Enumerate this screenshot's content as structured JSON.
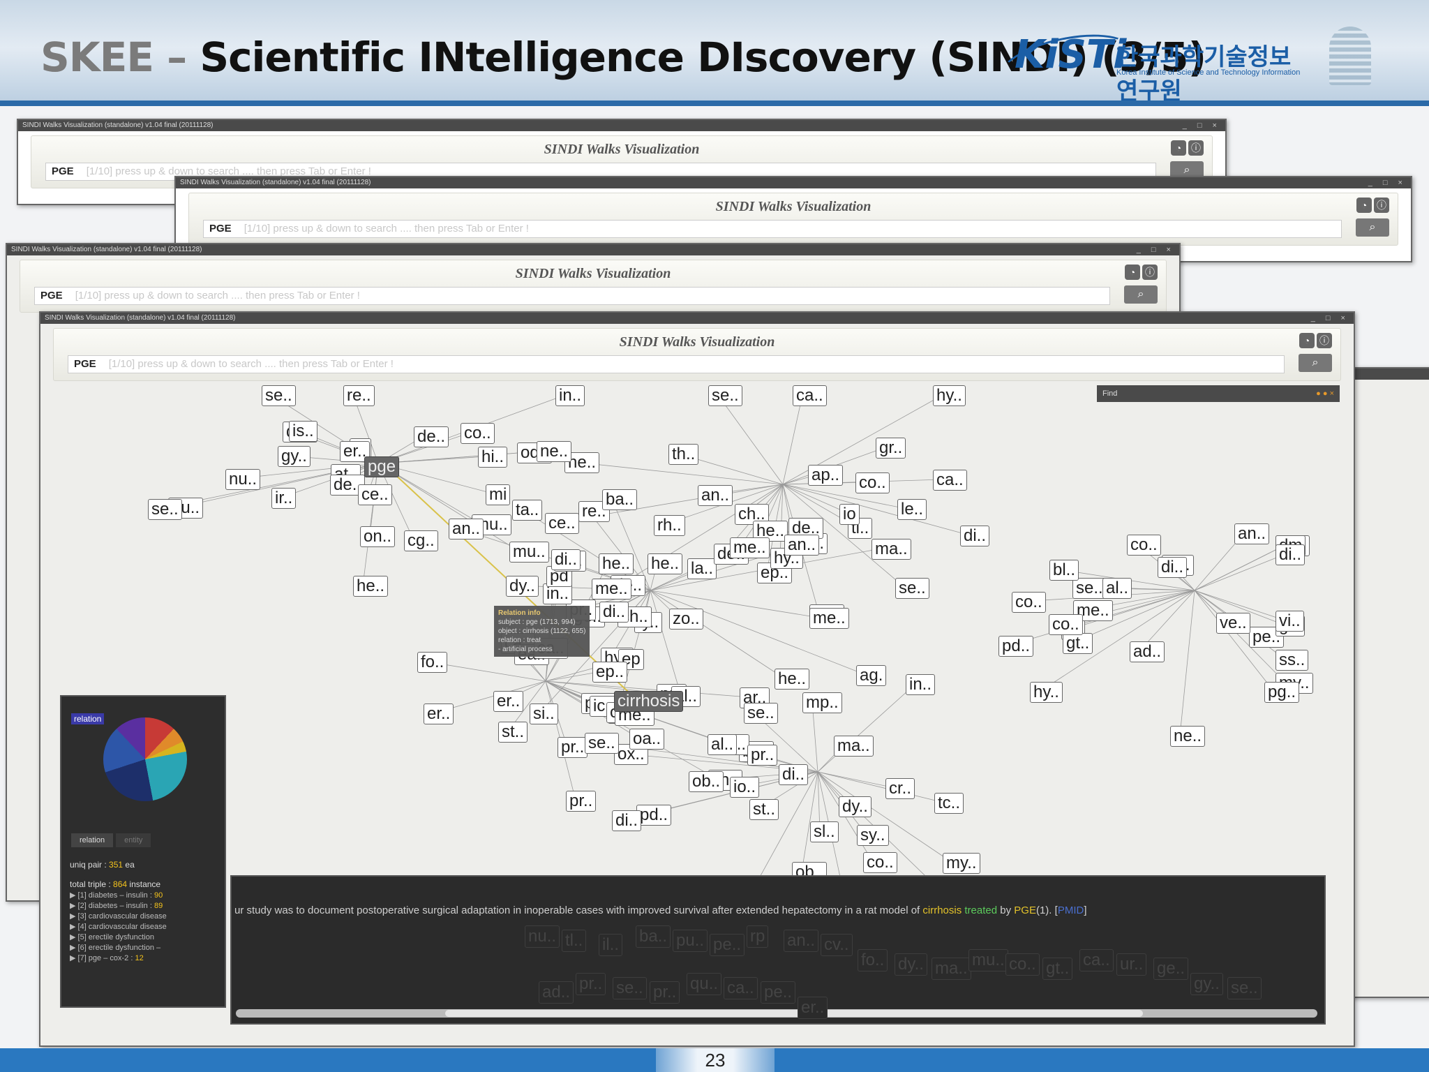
{
  "slide": {
    "brand": "SKEE",
    "dash": " – ",
    "title": "Scientific INtelligence DIscovery (SINDI) (3/5)",
    "logo_text": "KiSTi",
    "logo_kr": "한국과학기술정보연구원",
    "logo_en": "Korea Institute of Science and Technology Information",
    "page_number": "23"
  },
  "app": {
    "window_title": "SINDI Walks Visualization (standalone) v1.04 final (20111128)",
    "vis_title": "SINDI Walks Visualization",
    "search_value": "PGE",
    "search_placeholder": "[1/10] press up & down to search .... then press Tab or Enter !",
    "search_icon": "magnifier-icon",
    "find_label": "Find"
  },
  "graph": {
    "hub_labels": [
      "pge",
      "cirrhosis"
    ],
    "nodes": [
      "nu..",
      "tl..",
      "il..",
      "ba..",
      "pu..",
      "pe..",
      "rp",
      "an..",
      "cv..",
      "fo..",
      "dy..",
      "ma..",
      "mu..",
      "co..",
      "gt..",
      "ca..",
      "ur..",
      "ge..",
      "gy..",
      "se..",
      "ad..",
      "pr..",
      "se..",
      "pr..",
      "qu..",
      "ca..",
      "pe..",
      "er..",
      "tc..",
      "re..",
      "hi..",
      "rh..",
      "pd..",
      "er..",
      "sl..",
      "he..",
      "he..",
      "hy..",
      "co..",
      "in..",
      "di..",
      "hy..",
      "cg..",
      "se..",
      "ne..",
      "pr..",
      "al..",
      "ag.",
      "nu..",
      "th..",
      "my..",
      "ep",
      "cr..",
      "ba..",
      "se..",
      "an..",
      "ve..",
      "pa..",
      "ox..",
      "la..",
      "at..",
      "ep..",
      "gl..",
      "pr..",
      "ma..",
      "zo..",
      "er..",
      "ch..",
      "me..",
      "ar..",
      "pd..",
      "si..",
      "re..",
      "hy..",
      "ss..",
      "ic..",
      "sy..",
      "me..",
      "ir..",
      "he..",
      "se..",
      "ch..",
      "se..",
      "al..",
      "se..",
      "gr..",
      "co..",
      "he..",
      "se..",
      "ta..",
      "de..",
      "ca..",
      "co..",
      "pd",
      "ob..",
      "de..",
      "mi",
      "ce..",
      "di..",
      "ea..",
      "co..",
      "ty..",
      "od..",
      "le..",
      "pg..",
      "pr..",
      "th..",
      "cy..",
      "de..",
      "de..",
      "dm",
      "ox..",
      "io..",
      "ca..",
      "ce..",
      "di..",
      "co..",
      "ep..",
      "st..",
      "ch..",
      "mu..",
      "ap..",
      "al..",
      "st..",
      "mp..",
      "al..",
      "in..",
      "de..",
      "an..",
      "me..",
      "my..",
      "an..",
      "on..",
      "he..",
      "di..",
      "me..",
      "ob..",
      "he..",
      "ne..",
      "me..",
      "bl..",
      "oa..",
      "in..",
      "dy..",
      "is..",
      "io",
      "hy..",
      "di..",
      "di..",
      "di..",
      "co..",
      "an..",
      "vi.."
    ]
  },
  "info_box": {
    "heading": "Relation info",
    "lines": [
      "subject : pge (1713, 994)",
      "object : cirrhosis (1122, 655)",
      "relation : treat",
      "   - artificial process"
    ]
  },
  "relation_panel": {
    "title": "relation",
    "tabs": [
      "relation",
      "entity"
    ],
    "uniq_pair_label": "uniq pair : ",
    "uniq_pair_value": "351",
    "uniq_pair_unit": " ea",
    "total_triple_label": "total triple : ",
    "total_triple_value": "864",
    "total_triple_unit": " instance",
    "items": [
      {
        "label": "[1] diabetes – insulin : ",
        "count": "90"
      },
      {
        "label": "[2] diabetes – insulin : ",
        "count": "89"
      },
      {
        "label": "[3] cardiovascular disease",
        "count": ""
      },
      {
        "label": "[4] cardiovascular disease",
        "count": ""
      },
      {
        "label": "[5] erectile dysfunction",
        "count": ""
      },
      {
        "label": "[6] erectile dysfunction –",
        "count": ""
      },
      {
        "label": "[7] pge – cox-2 : ",
        "count": "12"
      }
    ],
    "pie_colors": [
      "#c73a36",
      "#e08a2a",
      "#d6b41f",
      "#2aa5b4",
      "#1d2f6a",
      "#2d56a8",
      "#5a2fa0"
    ]
  },
  "text_panel": {
    "prefix": "ur study was to document postoperative surgical adaptation in inoperable cases with improved survival after extended hepatectomy in a rat model of ",
    "object": "cirrhosis",
    "relation": " treated",
    "by": " by ",
    "subject": "PGE",
    "suffix": "(1).  [",
    "link": "PMID",
    "close": "]"
  }
}
